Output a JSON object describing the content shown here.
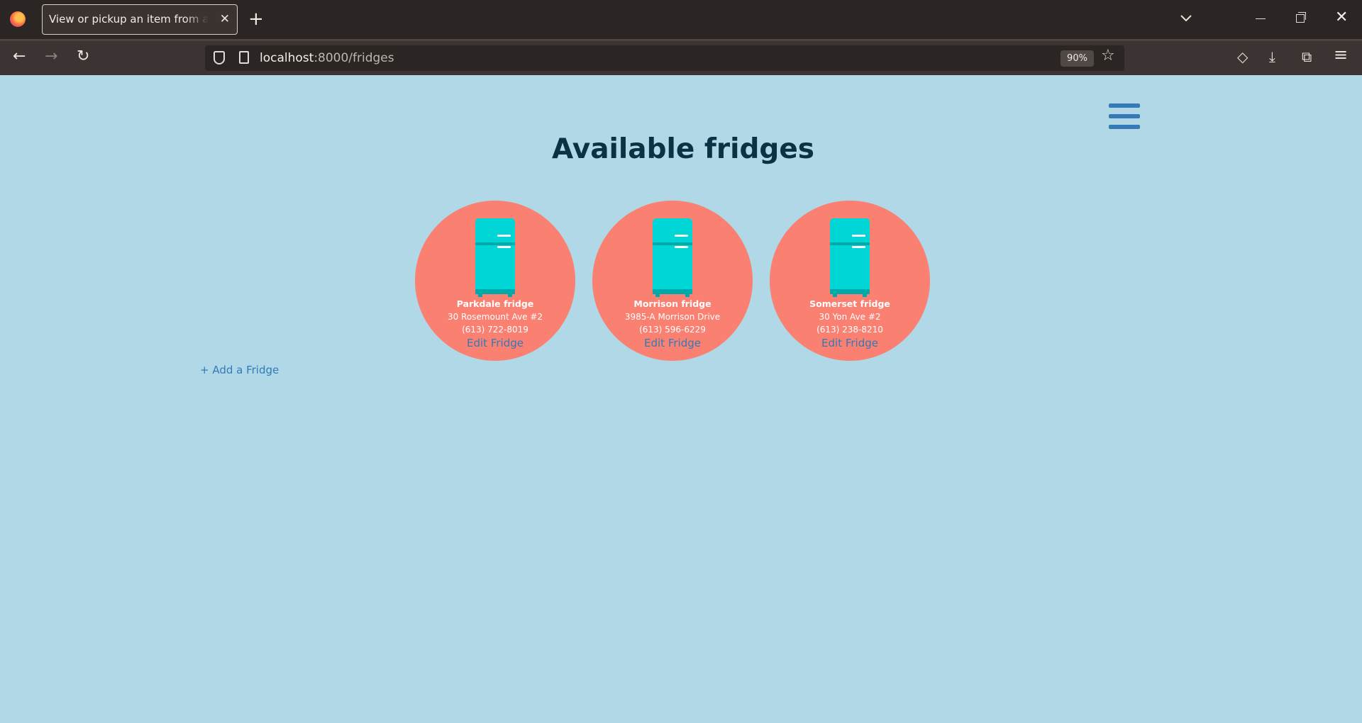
{
  "browser": {
    "tab_title": "View or pickup an item from a community fridge",
    "tab_close": "✕",
    "new_tab": "+",
    "tab_list": "⌄",
    "url_host": "localhost",
    "url_path": ":8000/fridges",
    "zoom": "90%",
    "window_min": "",
    "window_close": "✕",
    "back": "←",
    "forward": "→",
    "reload": "↻",
    "star": "☆",
    "pocket": "◇",
    "downloads": "⤓",
    "extensions": "⧉",
    "menu": "≡"
  },
  "page": {
    "heading": "Available fridges",
    "add_fridge": "+ Add a Fridge",
    "colors": {
      "background": "#b0d8e6",
      "circle": "#fa8072",
      "fridge": "#00d6d6",
      "link": "#337ab7",
      "heading": "#0c3142"
    }
  },
  "fridges": [
    {
      "name": "Parkdale fridge",
      "address": "30 Rosemount Ave #2",
      "phone": "(613) 722-8019",
      "edit_label": "Edit Fridge"
    },
    {
      "name": "Morrison fridge",
      "address": "3985-A Morrison Drive",
      "phone": "(613) 596-6229",
      "edit_label": "Edit Fridge"
    },
    {
      "name": "Somerset fridge",
      "address": "30 Yon Ave #2",
      "phone": "(613) 238-8210",
      "edit_label": "Edit Fridge"
    }
  ]
}
